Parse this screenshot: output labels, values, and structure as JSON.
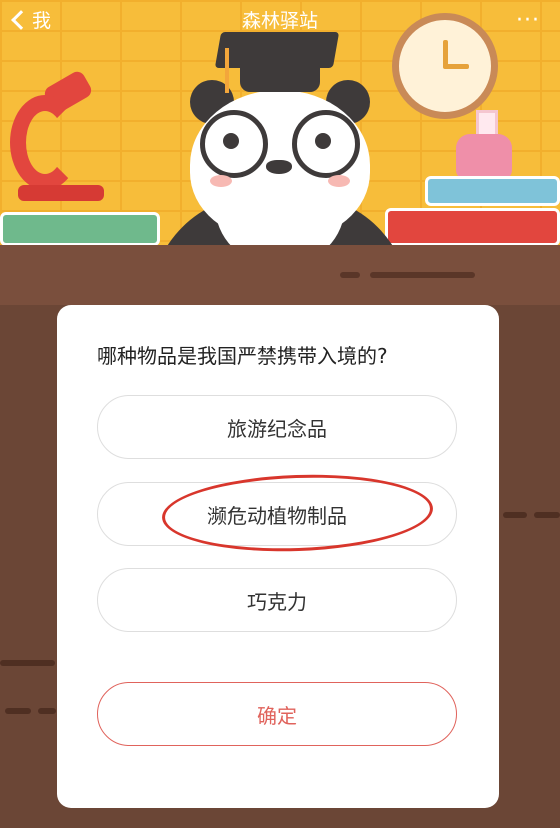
{
  "nav": {
    "back_label": "我",
    "title": "森林驿站",
    "more_label": "···"
  },
  "quiz": {
    "question": "哪种物品是我国严禁携带入境的?",
    "options": [
      "旅游纪念品",
      "濒危动植物制品",
      "巧克力"
    ],
    "confirm_label": "确定"
  },
  "colors": {
    "accent_red": "#e0635c",
    "highlight_circle": "#d8362c",
    "header_bg": "#f7bd3a",
    "wood": "#6b4636"
  }
}
